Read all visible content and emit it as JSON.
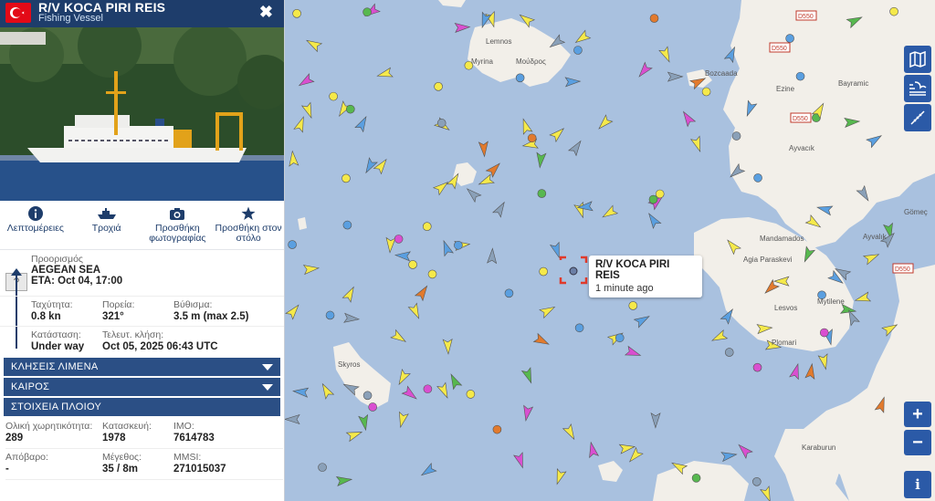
{
  "vessel": {
    "name": "R/V KOCA PIRI REIS",
    "type": "Fishing Vessel",
    "close_symbol": "✖"
  },
  "actions": [
    {
      "label": "Λεπτομέρειες",
      "icon": "info-icon"
    },
    {
      "label": "Τροχιά",
      "icon": "ship-track-icon"
    },
    {
      "label": "Προσθήκη φωτογραφίας",
      "icon": "camera-icon"
    },
    {
      "label": "Προσθήκη στον στόλο",
      "icon": "star-icon"
    }
  ],
  "voyage": {
    "destination_label": "Προορισμός",
    "destination": "AEGEAN SEA",
    "eta": "ETA: Oct 04, 17:00",
    "unknown_port_symbol": "?",
    "speed_label": "Ταχύτητα:",
    "speed": "0.8 kn",
    "course_label": "Πορεία:",
    "course": "321°",
    "draught_label": "Βύθισμα:",
    "draught": "3.5 m (max 2.5)",
    "status_label": "Κατάσταση:",
    "status": "Under way",
    "last_call_label": "Τελευτ. κλήση:",
    "last_call": "Oct 05, 2025 06:43 UTC"
  },
  "sections": {
    "port_calls": "ΚΛΗΣΕΙΣ ΛΙΜΕΝΑ",
    "weather": "ΚΑΙΡΟΣ",
    "vessel_info": "ΣΤΟΙΧΕΙΑ ΠΛΟΙΟΥ"
  },
  "particulars": {
    "gt_label": "Ολική χωρητικότητα:",
    "gt": "289",
    "built_label": "Κατασκευή:",
    "built": "1978",
    "imo_label": "IMO:",
    "imo": "7614783",
    "dwt_label": "Απόβαρο:",
    "dwt": "-",
    "size_label": "Μέγεθος:",
    "size": "35 / 8m",
    "mmsi_label": "MMSI:",
    "mmsi": "271015037"
  },
  "tooltip": {
    "name": "R/V KOCA PIRI REIS",
    "time": "1 minute ago"
  },
  "map_labels": {
    "lemnos": "Lemnos",
    "moudros": "Μούδρος",
    "myrina": "Myrina",
    "bozcaada": "Bozcaada",
    "ezine": "Ezine",
    "bayramic": "Bayramic",
    "ayvacik": "Ayvacık",
    "mandamados": "Mandamados",
    "agia_paraskevi": "Agia Paraskevi",
    "lesvos": "Lesvos",
    "mytilene": "Mytilene",
    "plomari": "Plomari",
    "skyros": "Skyros",
    "gomec": "Gömeç",
    "ayvalik": "Ayvalık",
    "karaburun": "Karaburun",
    "road_d550": "D550"
  },
  "controls": {
    "zoom_in": "+",
    "zoom_out": "−",
    "info": "i"
  },
  "colors": {
    "header": "#1e3d6b",
    "section_bar": "#2b4f85",
    "sea": "#a9c1df",
    "land": "#f2efe9",
    "control": "#2b5aa7"
  }
}
